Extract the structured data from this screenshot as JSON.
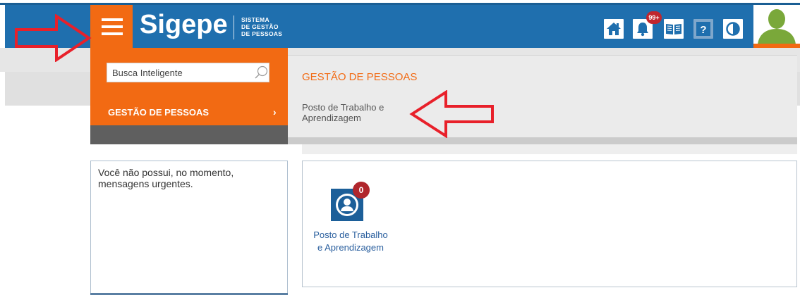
{
  "header": {
    "logo": "Sigepe",
    "logo_subtitle_lines": [
      "SISTEMA",
      "DE GESTÃO",
      "DE PESSOAS"
    ],
    "notification_count": "99+",
    "icons": [
      "menu-icon",
      "home-icon",
      "bell-icon",
      "book-icon",
      "help-icon",
      "contrast-icon",
      "user-avatar-icon",
      "chevron-down-icon"
    ]
  },
  "menu": {
    "search_placeholder": "Busca Inteligente",
    "item_label": "GESTÃO DE PESSOAS",
    "chevron": "›",
    "submenu_title": "GESTÃO DE PESSOAS",
    "submenu_item": "Posto de Trabalho e Aprendizagem"
  },
  "left_panel": {
    "message": "Você não possui, no momento, mensagens urgentes."
  },
  "apps": [
    {
      "label": "Posto de Trabalho e Aprendizagem",
      "badge": "0"
    }
  ],
  "colors": {
    "header_blue": "#1f6fae",
    "accent_orange": "#f26a13",
    "arrow_red": "#e8202a",
    "badge_red": "#b0262c"
  }
}
